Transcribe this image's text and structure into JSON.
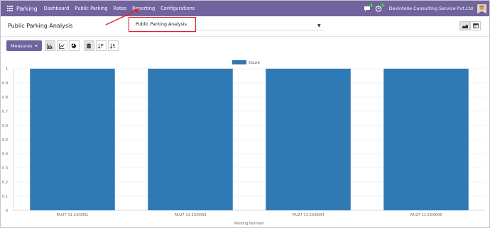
{
  "navbar": {
    "brand": "Parking",
    "menu": [
      "Dashboard",
      "Public Parking",
      "Rates",
      "Reporting",
      "Configurations"
    ],
    "chat_badge": "5",
    "activity_badge": "1",
    "company": "Devintelle Consulting Service Pvt.Ltd"
  },
  "control_panel": {
    "title": "Public Parking Analysis",
    "measures_label": "Measures"
  },
  "dropdown": {
    "item": "Public Parking Analysis"
  },
  "colors": {
    "navbar": "#71639e",
    "bar": "#2f79b5",
    "annotation": "#e0202a"
  },
  "chart_data": {
    "type": "bar",
    "categories": [
      "PA/27-11-23/0001",
      "PA/27-11-23/0003",
      "PA/27-11-23/0004",
      "PA/27-11-23/0005"
    ],
    "series": [
      {
        "name": "Count",
        "values": [
          1,
          1,
          1,
          1
        ]
      }
    ],
    "xlabel": "Parking Number",
    "ylabel": "",
    "ylim": [
      0,
      1
    ],
    "yticks": [
      "0",
      "0.1",
      "0.2",
      "0.3",
      "0.4",
      "0.5",
      "0.6",
      "0.7",
      "0.8",
      "0.9",
      "1"
    ],
    "grid": true,
    "legend": "top-center"
  }
}
